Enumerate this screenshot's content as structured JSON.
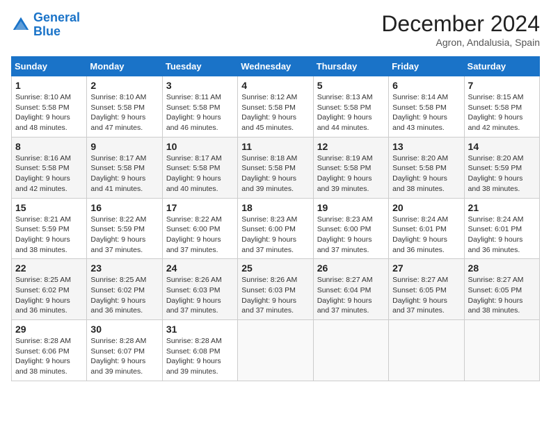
{
  "header": {
    "logo_line1": "General",
    "logo_line2": "Blue",
    "month_title": "December 2024",
    "subtitle": "Agron, Andalusia, Spain"
  },
  "weekdays": [
    "Sunday",
    "Monday",
    "Tuesday",
    "Wednesday",
    "Thursday",
    "Friday",
    "Saturday"
  ],
  "weeks": [
    [
      {
        "day": "1",
        "info": "Sunrise: 8:10 AM\nSunset: 5:58 PM\nDaylight: 9 hours\nand 48 minutes."
      },
      {
        "day": "2",
        "info": "Sunrise: 8:10 AM\nSunset: 5:58 PM\nDaylight: 9 hours\nand 47 minutes."
      },
      {
        "day": "3",
        "info": "Sunrise: 8:11 AM\nSunset: 5:58 PM\nDaylight: 9 hours\nand 46 minutes."
      },
      {
        "day": "4",
        "info": "Sunrise: 8:12 AM\nSunset: 5:58 PM\nDaylight: 9 hours\nand 45 minutes."
      },
      {
        "day": "5",
        "info": "Sunrise: 8:13 AM\nSunset: 5:58 PM\nDaylight: 9 hours\nand 44 minutes."
      },
      {
        "day": "6",
        "info": "Sunrise: 8:14 AM\nSunset: 5:58 PM\nDaylight: 9 hours\nand 43 minutes."
      },
      {
        "day": "7",
        "info": "Sunrise: 8:15 AM\nSunset: 5:58 PM\nDaylight: 9 hours\nand 42 minutes."
      }
    ],
    [
      {
        "day": "8",
        "info": "Sunrise: 8:16 AM\nSunset: 5:58 PM\nDaylight: 9 hours\nand 42 minutes."
      },
      {
        "day": "9",
        "info": "Sunrise: 8:17 AM\nSunset: 5:58 PM\nDaylight: 9 hours\nand 41 minutes."
      },
      {
        "day": "10",
        "info": "Sunrise: 8:17 AM\nSunset: 5:58 PM\nDaylight: 9 hours\nand 40 minutes."
      },
      {
        "day": "11",
        "info": "Sunrise: 8:18 AM\nSunset: 5:58 PM\nDaylight: 9 hours\nand 39 minutes."
      },
      {
        "day": "12",
        "info": "Sunrise: 8:19 AM\nSunset: 5:58 PM\nDaylight: 9 hours\nand 39 minutes."
      },
      {
        "day": "13",
        "info": "Sunrise: 8:20 AM\nSunset: 5:58 PM\nDaylight: 9 hours\nand 38 minutes."
      },
      {
        "day": "14",
        "info": "Sunrise: 8:20 AM\nSunset: 5:59 PM\nDaylight: 9 hours\nand 38 minutes."
      }
    ],
    [
      {
        "day": "15",
        "info": "Sunrise: 8:21 AM\nSunset: 5:59 PM\nDaylight: 9 hours\nand 38 minutes."
      },
      {
        "day": "16",
        "info": "Sunrise: 8:22 AM\nSunset: 5:59 PM\nDaylight: 9 hours\nand 37 minutes."
      },
      {
        "day": "17",
        "info": "Sunrise: 8:22 AM\nSunset: 6:00 PM\nDaylight: 9 hours\nand 37 minutes."
      },
      {
        "day": "18",
        "info": "Sunrise: 8:23 AM\nSunset: 6:00 PM\nDaylight: 9 hours\nand 37 minutes."
      },
      {
        "day": "19",
        "info": "Sunrise: 8:23 AM\nSunset: 6:00 PM\nDaylight: 9 hours\nand 37 minutes."
      },
      {
        "day": "20",
        "info": "Sunrise: 8:24 AM\nSunset: 6:01 PM\nDaylight: 9 hours\nand 36 minutes."
      },
      {
        "day": "21",
        "info": "Sunrise: 8:24 AM\nSunset: 6:01 PM\nDaylight: 9 hours\nand 36 minutes."
      }
    ],
    [
      {
        "day": "22",
        "info": "Sunrise: 8:25 AM\nSunset: 6:02 PM\nDaylight: 9 hours\nand 36 minutes."
      },
      {
        "day": "23",
        "info": "Sunrise: 8:25 AM\nSunset: 6:02 PM\nDaylight: 9 hours\nand 36 minutes."
      },
      {
        "day": "24",
        "info": "Sunrise: 8:26 AM\nSunset: 6:03 PM\nDaylight: 9 hours\nand 37 minutes."
      },
      {
        "day": "25",
        "info": "Sunrise: 8:26 AM\nSunset: 6:03 PM\nDaylight: 9 hours\nand 37 minutes."
      },
      {
        "day": "26",
        "info": "Sunrise: 8:27 AM\nSunset: 6:04 PM\nDaylight: 9 hours\nand 37 minutes."
      },
      {
        "day": "27",
        "info": "Sunrise: 8:27 AM\nSunset: 6:05 PM\nDaylight: 9 hours\nand 37 minutes."
      },
      {
        "day": "28",
        "info": "Sunrise: 8:27 AM\nSunset: 6:05 PM\nDaylight: 9 hours\nand 38 minutes."
      }
    ],
    [
      {
        "day": "29",
        "info": "Sunrise: 8:28 AM\nSunset: 6:06 PM\nDaylight: 9 hours\nand 38 minutes."
      },
      {
        "day": "30",
        "info": "Sunrise: 8:28 AM\nSunset: 6:07 PM\nDaylight: 9 hours\nand 39 minutes."
      },
      {
        "day": "31",
        "info": "Sunrise: 8:28 AM\nSunset: 6:08 PM\nDaylight: 9 hours\nand 39 minutes."
      },
      null,
      null,
      null,
      null
    ]
  ]
}
